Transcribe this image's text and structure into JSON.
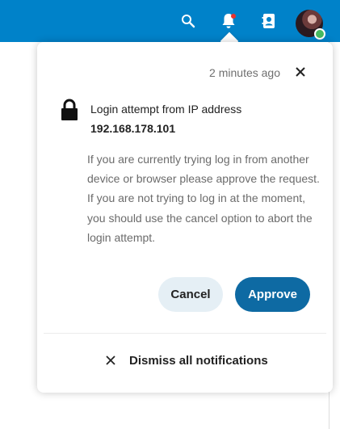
{
  "header": {
    "icons": [
      "search-icon",
      "notifications-icon",
      "contacts-icon"
    ],
    "accent_color": "#0082c9",
    "avatar_status_color": "#46ba61"
  },
  "notification": {
    "timestamp": "2 minutes ago",
    "title": "Login attempt from IP address",
    "ip": "192.168.178.101",
    "body": "If you are currently trying log in from another device or browser please approve the request. If you are not trying to log in at the moment, you should use the cancel option to abort the login attempt.",
    "cancel_label": "Cancel",
    "approve_label": "Approve"
  },
  "footer": {
    "dismiss_label": "Dismiss all notifications"
  }
}
